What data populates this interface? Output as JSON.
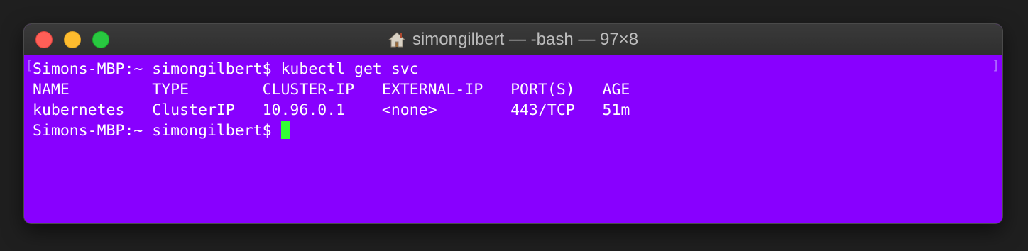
{
  "window": {
    "title": "simongilbert — -bash — 97×8",
    "title_icon": "home-icon"
  },
  "terminal": {
    "background": "#8800ff",
    "cursor_color": "#33ff33",
    "left_bracket": "[",
    "right_bracket": "]",
    "lines": [
      "Simons-MBP:~ simongilbert$ kubectl get svc",
      "NAME         TYPE        CLUSTER-IP   EXTERNAL-IP   PORT(S)   AGE",
      "kubernetes   ClusterIP   10.96.0.1    <none>        443/TCP   51m"
    ],
    "prompt": "Simons-MBP:~ simongilbert$ "
  }
}
